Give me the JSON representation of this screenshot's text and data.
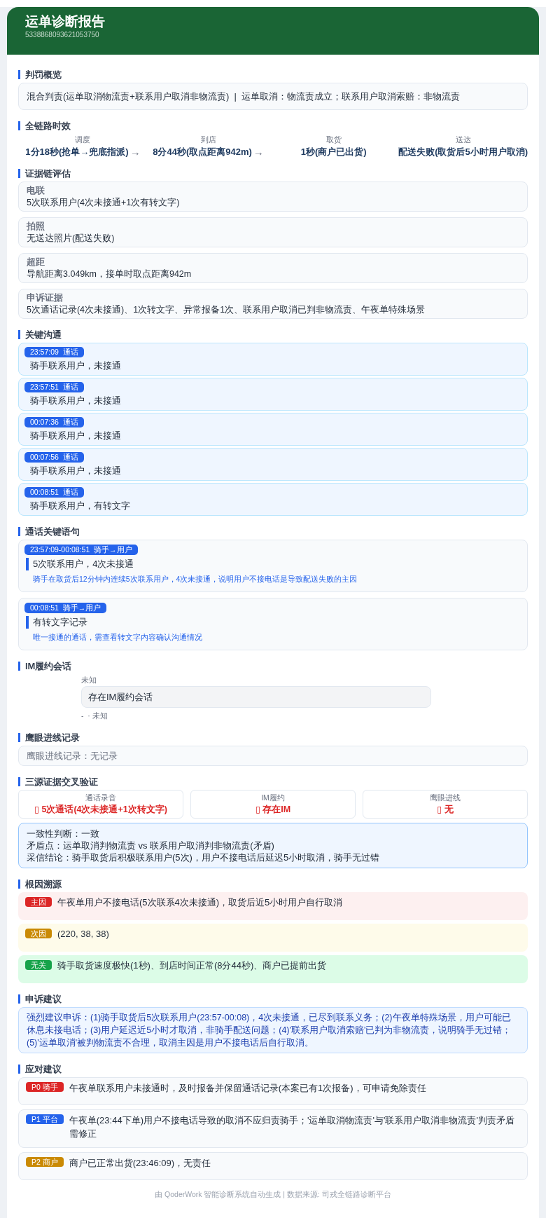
{
  "header": {
    "title": "运单诊断报告",
    "order_id": "5338868093621053750"
  },
  "penalty_overview": {
    "title": "判罚概览",
    "text": "混合判责(运单取消物流责+联系用户取消非物流责)  |  运单取消：物流责成立；联系用户取消索赔：非物流责"
  },
  "timeline": {
    "title": "全链路时效",
    "steps": [
      {
        "label": "调度",
        "value": "1分18秒(抢单→兜底指派)",
        "arrow": "→"
      },
      {
        "label": "到店",
        "value": "8分44秒(取点距离942m)",
        "arrow": "→"
      },
      {
        "label": "取货",
        "value": "1秒(商户已出货)"
      },
      {
        "label": "送达",
        "value": "配送失败(取货后5小时用户取消)"
      }
    ]
  },
  "evidence": {
    "title": "证据链评估",
    "items": [
      {
        "label": "电联",
        "text": "5次联系用户(4次未接通+1次有转文字)"
      },
      {
        "label": "拍照",
        "text": "无送达照片(配送失败)"
      },
      {
        "label": "超距",
        "text": "导航距离3.049km，接单时取点距离942m"
      },
      {
        "label": "申诉证据",
        "text": "5次通话记录(4次未接通)、1次转文字、异常报备1次、联系用户取消已判非物流责、午夜单特殊场景"
      }
    ]
  },
  "key_communication": {
    "title": "关键沟通",
    "items": [
      {
        "badge": "23:57:09  通话",
        "text": "骑手联系用户，未接通"
      },
      {
        "badge": "23:57:51  通话",
        "text": "骑手联系用户，未接通"
      },
      {
        "badge": "00:07:36  通话",
        "text": "骑手联系用户，未接通"
      },
      {
        "badge": "00:07:56  通话",
        "text": "骑手联系用户，未接通"
      },
      {
        "badge": "00:08:51  通话",
        "text": "骑手联系用户，有转文字"
      }
    ]
  },
  "call_key_sentences": {
    "title": "通话关键语句",
    "items": [
      {
        "badge": "23:57:09-00:08:51  骑手→用户",
        "sentence": "5次联系用户，4次未接通",
        "note": "骑手在取货后12分钟内连续5次联系用户，4次未接通，说明用户不接电话是导致配送失败的主因"
      },
      {
        "badge": "00:08:51  骑手→用户",
        "sentence": "有转文字记录",
        "note": "唯一接通的通话，需查看转文字内容确认沟通情况"
      }
    ]
  },
  "im_session": {
    "title": "IM履约会话",
    "top_label": "未知",
    "text": "存在IM履约会话",
    "bottom_label": "-  · 未知"
  },
  "eagle_eye": {
    "title": "鹰眼进线记录",
    "text": "鹰眼进线记录：无记录"
  },
  "cross_verification": {
    "title": "三源证据交叉验证",
    "sources": [
      {
        "label": "通话录音",
        "value": "▯ 5次通话(4次未接通+1次转文字)"
      },
      {
        "label": "IM履约",
        "value": "▯ 存在IM"
      },
      {
        "label": "鹰眼进线",
        "value": "▯ 无"
      }
    ],
    "lines": [
      "一致性判断：一致",
      "矛盾点：运单取消判物流责 vs 联系用户取消判非物流责(矛盾)",
      "采信结论：骑手取货后积极联系用户(5次)，用户不接电话后延迟5小时取消，骑手无过错"
    ]
  },
  "root_cause": {
    "title": "根因溯源",
    "items": [
      {
        "tag": "主因",
        "color": "#dc2626",
        "text": "午夜单用户不接电话(5次联系4次未接通)，取货后近5小时用户自行取消"
      },
      {
        "tag": "次因",
        "color": "#ca8a04",
        "text": "(220, 38, 38)"
      },
      {
        "tag": "无关",
        "color": "#16a34a",
        "text": "骑手取货速度极快(1秒)、到店时间正常(8分44秒)、商户已提前出货"
      }
    ]
  },
  "appeal": {
    "title": "申诉建议",
    "text": "强烈建议申诉：(1)骑手取货后5次联系用户(23:57-00:08)，4次未接通，已尽到联系义务；(2)午夜单特殊场景，用户可能已休息未接电话；(3)用户延迟近5小时才取消，非骑手配送问题；(4)'联系用户取消索赔'已判为非物流责，说明骑手无过错；(5)'运单取消'被判物流责不合理，取消主因是用户不接电话后自行取消。"
  },
  "response": {
    "title": "应对建议",
    "items": [
      {
        "tag": "P0 骑手",
        "color": "#dc2626",
        "text": "午夜单联系用户未接通时，及时报备并保留通话记录(本案已有1次报备)，可申请免除责任"
      },
      {
        "tag": "P1 平台",
        "color": "#2563eb",
        "text": "午夜单(23:44下单)用户不接电话导致的取消不应归责骑手；'运单取消物流责'与'联系用户取消非物流责'判责矛盾需修正"
      },
      {
        "tag": "P2 商户",
        "color": "#ca8a04",
        "text": "商户已正常出货(23:46:09)，无责任"
      }
    ]
  },
  "footer": "由 QoderWork 智能诊断系统自动生成 | 数据来源: 司戎全链路诊断平台"
}
